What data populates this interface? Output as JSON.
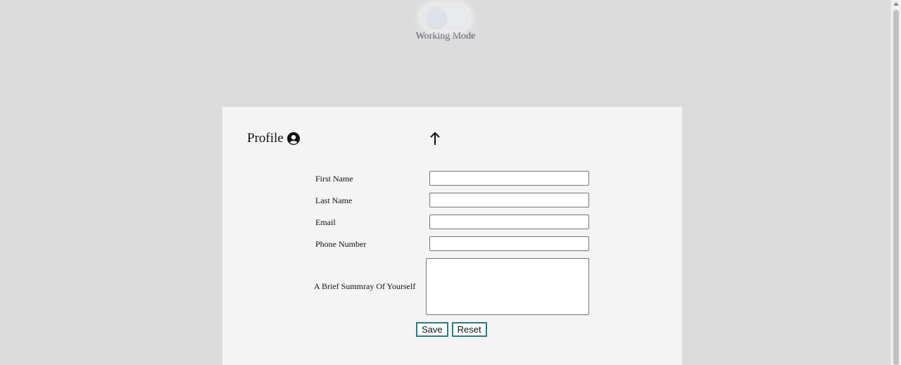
{
  "toggle": {
    "label": "Working Mode",
    "state": "off"
  },
  "profile": {
    "title": "Profile",
    "title_icon": "user-circle-icon",
    "top_icon": "arrow-up-icon"
  },
  "form": {
    "first_name": {
      "label": "First Name",
      "value": ""
    },
    "last_name": {
      "label": "Last Name",
      "value": ""
    },
    "email": {
      "label": "Email",
      "value": ""
    },
    "phone": {
      "label": "Phone Number",
      "value": ""
    },
    "summary": {
      "label": "A Brief Summray Of Yourself",
      "value": ""
    }
  },
  "buttons": {
    "save": "Save",
    "reset": "Reset"
  },
  "colors": {
    "background": "#dcdcdc",
    "card": "#f4f4f4",
    "button_border": "#2a7d80",
    "toggle_label": "#555a63"
  }
}
